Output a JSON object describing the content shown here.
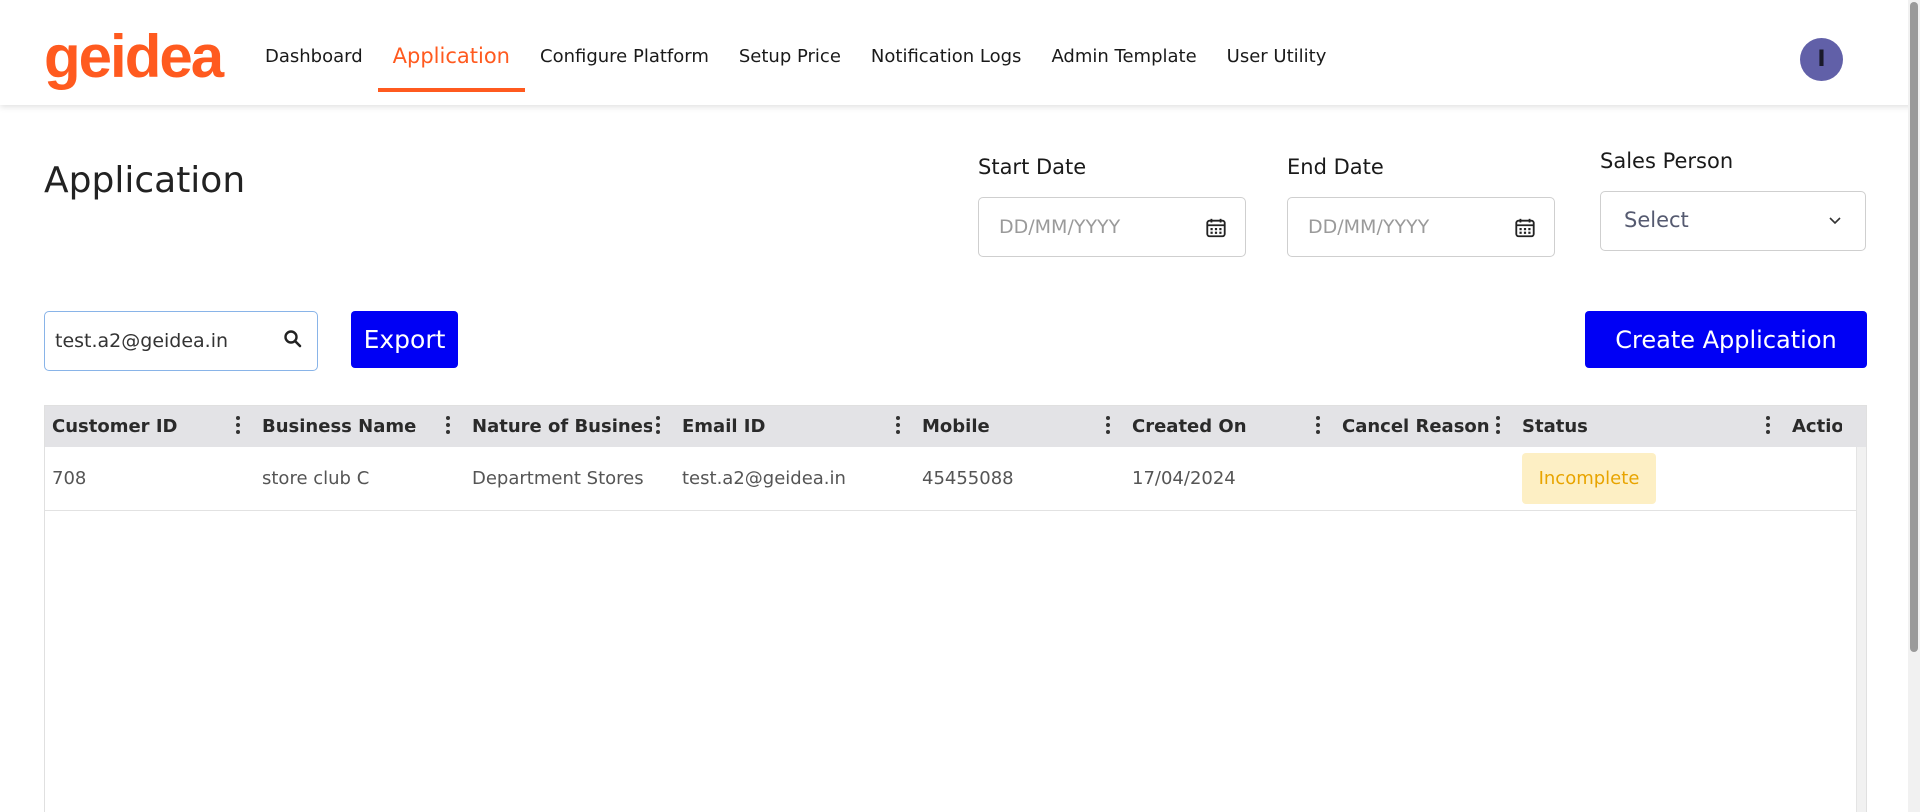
{
  "header": {
    "logo": "geidea",
    "nav": [
      {
        "label": "Dashboard"
      },
      {
        "label": "Application",
        "active": true
      },
      {
        "label": "Configure Platform"
      },
      {
        "label": "Setup Price"
      },
      {
        "label": "Notification Logs"
      },
      {
        "label": "Admin Template"
      },
      {
        "label": "User Utility"
      }
    ],
    "avatar_initial": "I"
  },
  "page": {
    "title": "Application"
  },
  "filters": {
    "start_date_label": "Start Date",
    "start_date_placeholder": "DD/MM/YYYY",
    "end_date_label": "End Date",
    "end_date_placeholder": "DD/MM/YYYY",
    "sales_person_label": "Sales Person",
    "sales_person_value": "Select"
  },
  "toolbar": {
    "search_value": "test.a2@geidea.in",
    "export_label": "Export",
    "create_label": "Create Application"
  },
  "table": {
    "columns": [
      "Customer ID",
      "Business Name",
      "Nature of Business",
      "Email ID",
      "Mobile",
      "Created On",
      "Cancel Reason",
      "Status",
      "Actio"
    ],
    "rows": [
      {
        "customer_id": "708",
        "business_name": "store club C",
        "nature_of_business": "Department Stores",
        "email_id": "test.a2@geidea.in",
        "mobile": "45455088",
        "created_on": "17/04/2024",
        "cancel_reason": "",
        "status": "Incomplete",
        "action": ""
      }
    ]
  },
  "colors": {
    "brand": "#ff5a1f",
    "primary_button": "#0000f5",
    "status_incomplete_bg": "#fdefc4",
    "status_incomplete_text": "#e8a400",
    "avatar": "#6160a8"
  }
}
